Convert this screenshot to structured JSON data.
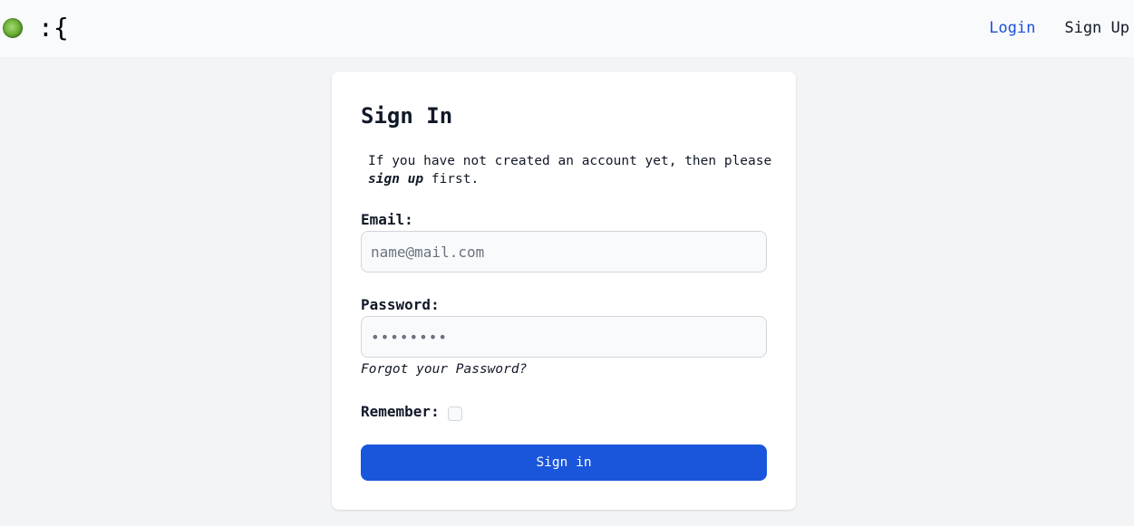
{
  "nav": {
    "logo_icon": "green-orb-logo-icon",
    "brand": ":{",
    "login": "Login",
    "signup": "Sign Up",
    "accent_color": "#1d4ed8"
  },
  "signin": {
    "title": "Sign In",
    "intro_before": "If you have not created an account yet, then please ",
    "intro_emphasis": "sign up",
    "intro_after": " first.",
    "email_label": "Email:",
    "email_placeholder": "name@mail.com",
    "email_value": "",
    "password_label": "Password:",
    "password_placeholder": "••••••••",
    "password_value": "",
    "forgot": "Forgot your Password?",
    "remember_label": "Remember:",
    "remember_checked": false,
    "button": "Sign in",
    "button_color": "#1a56db"
  }
}
